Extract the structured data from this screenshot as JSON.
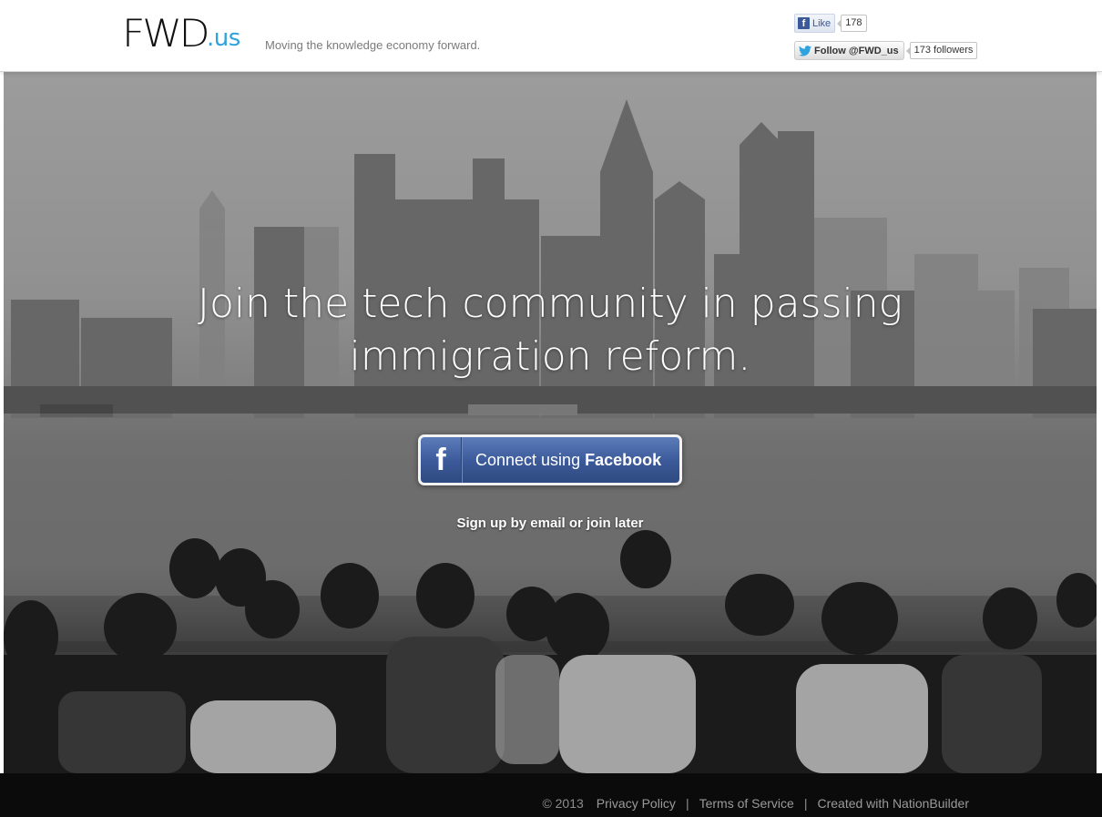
{
  "header": {
    "logo_main": "FWD",
    "logo_ext": ".us",
    "tagline": "Moving the knowledge economy forward.",
    "facebook_like": {
      "label": "Like",
      "count": "178"
    },
    "twitter_follow": {
      "label": "Follow @FWD_us",
      "count": "173 followers"
    }
  },
  "hero": {
    "headline_line1": "Join the tech community in passing",
    "headline_line2": "immigration reform.",
    "connect_button": {
      "prefix": "Connect using ",
      "brand": "Facebook",
      "icon": "facebook-f-icon"
    },
    "signup_link": "Sign up by email or join later"
  },
  "footer": {
    "copyright": "© 2013",
    "links": [
      "Privacy Policy",
      "Terms of Service",
      "Created with NationBuilder"
    ]
  },
  "colors": {
    "facebook_blue": "#3b5998",
    "logo_accent": "#2ea3dd",
    "footer_bg": "#0b0b0b"
  }
}
